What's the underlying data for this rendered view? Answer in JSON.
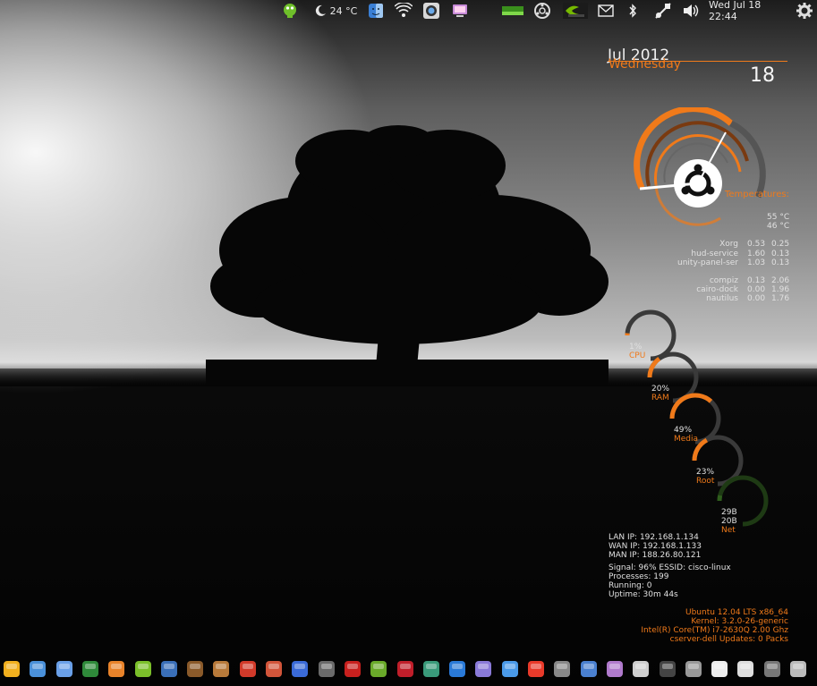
{
  "top_panel": {
    "weather_temp": "24 °C",
    "clock": "Wed Jul 18 22:44",
    "icons": [
      "chat-icon",
      "weather-moon-icon",
      "finder-icon",
      "wifi-broadcast-icon",
      "camera-icon",
      "screenshot-icon",
      "battery-icon",
      "ubuntu-icon",
      "nvidia-icon",
      "mail-icon",
      "bluetooth-icon",
      "network-icon",
      "volume-icon",
      "settings-gear-icon"
    ]
  },
  "calendar": {
    "month_year": "Jul 2012",
    "weekday": "Wednesday",
    "day": "18"
  },
  "temperatures": {
    "title": "Temperatures:",
    "t1": "55 °C",
    "t2": "46 °C"
  },
  "processes": [
    {
      "name": "Xorg",
      "a": "0.53",
      "b": "0.25"
    },
    {
      "name": "hud-service",
      "a": "1.60",
      "b": "0.13"
    },
    {
      "name": "unity-panel-ser",
      "a": "1.03",
      "b": "0.13"
    },
    {
      "name": "compiz",
      "a": "0.13",
      "b": "2.06"
    },
    {
      "name": "cairo-dock",
      "a": "0.00",
      "b": "1.96"
    },
    {
      "name": "nautilus",
      "a": "0.00",
      "b": "1.76"
    }
  ],
  "gauges": [
    {
      "value": "1%",
      "label": "CPU",
      "level": 0.01
    },
    {
      "value": "20%",
      "label": "RAM",
      "level": 0.2
    },
    {
      "value": "49%",
      "label": "Media",
      "level": 0.49
    },
    {
      "value": "23%",
      "label": "Root",
      "level": 0.23
    },
    {
      "value": "29B",
      "value2": "20B",
      "label": "Net",
      "level": 0.05
    }
  ],
  "network": {
    "lan": "LAN IP: 192.168.1.134",
    "wan": "WAN IP: 192.168.1.133",
    "man": "MAN IP: 188.26.80.121",
    "signal": "Signal: 96%  ESSID: cisco-linux",
    "processes": "Processes: 199",
    "running": "Running: 0",
    "uptime": "Uptime: 30m 44s"
  },
  "sysinfo": {
    "os": "Ubuntu 12.04 LTS  x86_64",
    "kernel": "Kernel: 3.2.0-26-generic",
    "cpu": "Intel(R) Core(TM) i7-2630Q    2.00 Ghz",
    "host": "cserver-dell   Updates: 0 Packs"
  },
  "dock": {
    "icons": [
      "lightning-icon",
      "finder-window-icon",
      "video-clapper-icon",
      "vmware-icon",
      "media-player-icon",
      "um-icon",
      "qbittorrent-icon",
      "cookies-icon",
      "gimp-icon",
      "ubuntu-software-icon",
      "pirate-icon",
      "puzzle-icon",
      "hub-icon",
      "filezilla-icon",
      "android-icon",
      "redbull-icon",
      "wine-dragon-icon",
      "globe-icon",
      "disc-icon",
      "weather-drop-icon",
      "refresh-icon",
      "trash-icon",
      "finder-icon",
      "screen-capture-icon",
      "magnifier-icon",
      "gdock-icon",
      "volume-mixer-icon",
      "clock-icon",
      "grid-apps-icon",
      "trash-bin-icon",
      "power-icon"
    ]
  }
}
